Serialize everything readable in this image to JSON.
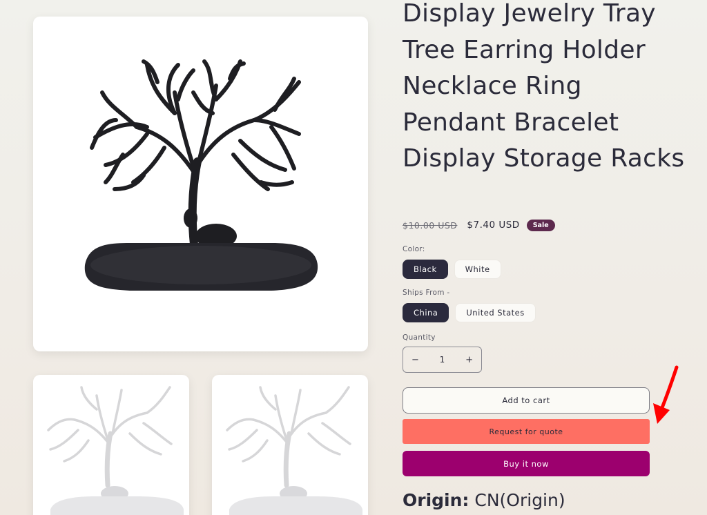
{
  "product": {
    "title": "Display Jewelry Tray Tree Earring Holder Necklace Ring Pendant Bracelet Display Storage Racks",
    "price_compare": "$10.00 USD",
    "price_sale": "$7.40 USD",
    "sale_badge": "Sale"
  },
  "options": {
    "color": {
      "label": "Color:",
      "values": [
        "Black",
        "White"
      ],
      "selected": "Black"
    },
    "ships_from": {
      "label": "Ships From -",
      "values": [
        "China",
        "United States"
      ],
      "selected": "China"
    }
  },
  "quantity": {
    "label": "Quantity",
    "value": "1",
    "minus": "−",
    "plus": "+"
  },
  "buttons": {
    "add_to_cart": "Add to cart",
    "request_quote": "Request for quote",
    "buy_now": "Buy it now"
  },
  "origin": {
    "label": "Origin:",
    "value": "CN(Origin)"
  },
  "colors": {
    "selected_pill": "#2b2a3d",
    "quote_button": "#fe6f63",
    "buy_button": "#9c006e",
    "sale_badge": "#5d2a4e",
    "annotation_arrow": "#ff0000"
  },
  "media": {
    "main_image": "black-deer-tree-jewelry-stand",
    "thumbnails": [
      "white-deer-tree-jewelry-stand",
      "white-deer-tree-jewelry-stand"
    ]
  }
}
